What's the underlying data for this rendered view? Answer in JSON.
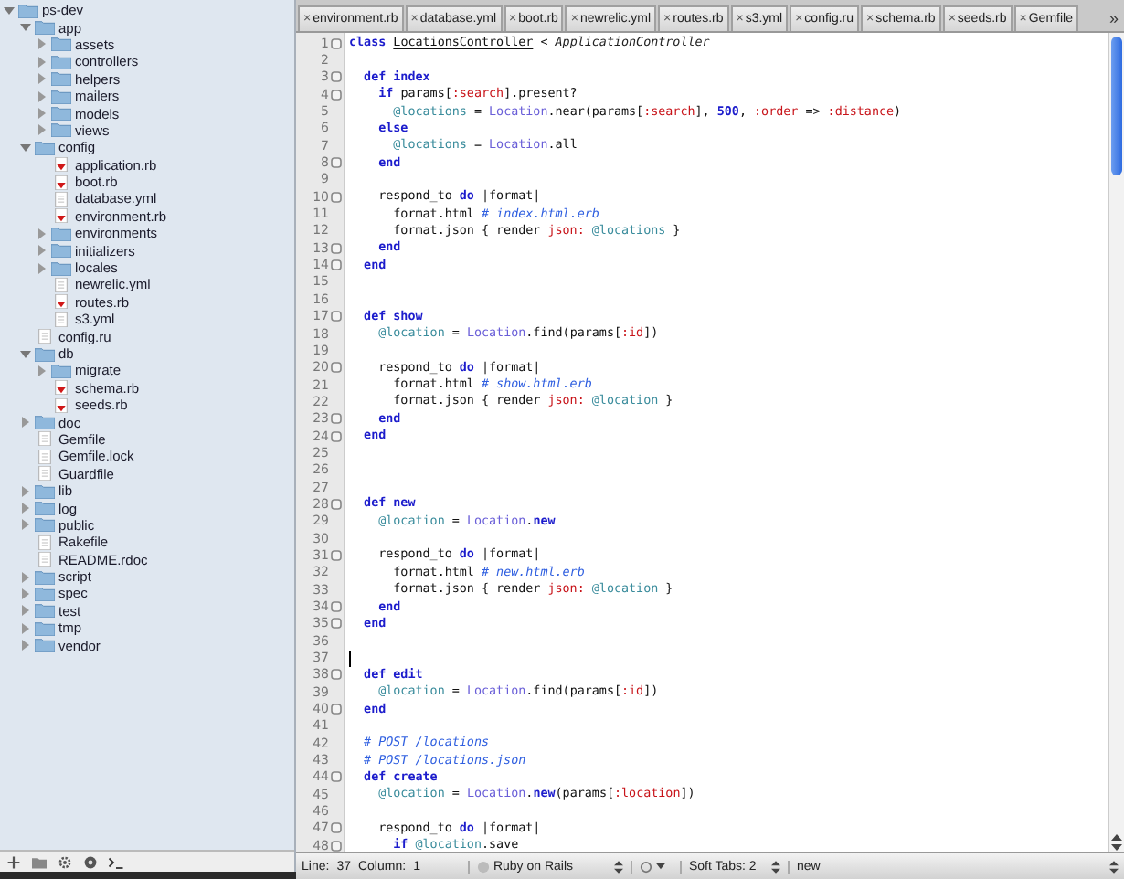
{
  "sidebar": {
    "tree": [
      {
        "name": "ps-dev",
        "kind": "folder",
        "expanded": true,
        "children": [
          {
            "name": "app",
            "kind": "folder",
            "expanded": true,
            "children": [
              {
                "name": "assets",
                "kind": "folder",
                "expanded": false
              },
              {
                "name": "controllers",
                "kind": "folder",
                "expanded": false
              },
              {
                "name": "helpers",
                "kind": "folder",
                "expanded": false
              },
              {
                "name": "mailers",
                "kind": "folder",
                "expanded": false
              },
              {
                "name": "models",
                "kind": "folder",
                "expanded": false
              },
              {
                "name": "views",
                "kind": "folder",
                "expanded": false
              }
            ]
          },
          {
            "name": "config",
            "kind": "folder",
            "expanded": true,
            "children": [
              {
                "name": "application.rb",
                "kind": "ruby"
              },
              {
                "name": "boot.rb",
                "kind": "ruby"
              },
              {
                "name": "database.yml",
                "kind": "file"
              },
              {
                "name": "environment.rb",
                "kind": "ruby"
              },
              {
                "name": "environments",
                "kind": "folder",
                "expanded": false
              },
              {
                "name": "initializers",
                "kind": "folder",
                "expanded": false
              },
              {
                "name": "locales",
                "kind": "folder",
                "expanded": false
              },
              {
                "name": "newrelic.yml",
                "kind": "file"
              },
              {
                "name": "routes.rb",
                "kind": "ruby"
              },
              {
                "name": "s3.yml",
                "kind": "file"
              }
            ]
          },
          {
            "name": "config.ru",
            "kind": "file"
          },
          {
            "name": "db",
            "kind": "folder",
            "expanded": true,
            "children": [
              {
                "name": "migrate",
                "kind": "folder",
                "expanded": false
              },
              {
                "name": "schema.rb",
                "kind": "ruby"
              },
              {
                "name": "seeds.rb",
                "kind": "ruby"
              }
            ]
          },
          {
            "name": "doc",
            "kind": "folder",
            "expanded": false
          },
          {
            "name": "Gemfile",
            "kind": "file"
          },
          {
            "name": "Gemfile.lock",
            "kind": "file"
          },
          {
            "name": "Guardfile",
            "kind": "file"
          },
          {
            "name": "lib",
            "kind": "folder",
            "expanded": false
          },
          {
            "name": "log",
            "kind": "folder",
            "expanded": false
          },
          {
            "name": "public",
            "kind": "folder",
            "expanded": false
          },
          {
            "name": "Rakefile",
            "kind": "file"
          },
          {
            "name": "README.rdoc",
            "kind": "file"
          },
          {
            "name": "script",
            "kind": "folder",
            "expanded": false
          },
          {
            "name": "spec",
            "kind": "folder",
            "expanded": false
          },
          {
            "name": "test",
            "kind": "folder",
            "expanded": false
          },
          {
            "name": "tmp",
            "kind": "folder",
            "expanded": false
          },
          {
            "name": "vendor",
            "kind": "folder",
            "expanded": false
          }
        ]
      }
    ]
  },
  "tabs": [
    {
      "close": "×",
      "label": "environment.rb"
    },
    {
      "close": "×",
      "label": "database.yml"
    },
    {
      "close": "×",
      "label": "boot.rb"
    },
    {
      "close": "×",
      "label": "newrelic.yml"
    },
    {
      "close": "×",
      "label": "routes.rb"
    },
    {
      "close": "×",
      "label": "s3.yml"
    },
    {
      "close": "×",
      "label": "config.ru"
    },
    {
      "close": "×",
      "label": "schema.rb"
    },
    {
      "close": "×",
      "label": "seeds.rb"
    },
    {
      "close": "×",
      "label": "Gemfile"
    }
  ],
  "tab_overflow": "»",
  "editor": {
    "lines": [
      {
        "number": "1",
        "fold": true,
        "caret": false,
        "tokens": [
          {
            "text": "class ",
            "kind": "keyword"
          },
          {
            "text": "LocationsController",
            "kind": "class"
          },
          {
            "text": " < ",
            "kind": "plain"
          },
          {
            "text": "ApplicationController",
            "kind": "superclass"
          }
        ]
      },
      {
        "number": "2",
        "fold": false,
        "caret": false
      },
      {
        "number": "3",
        "fold": true,
        "caret": false,
        "tokens": [
          {
            "text": "  def index",
            "kind": "keyword"
          }
        ]
      },
      {
        "number": "4",
        "fold": true,
        "caret": false,
        "tokens": [
          {
            "text": "    if ",
            "kind": "keyword"
          },
          {
            "text": "params[",
            "kind": "plain"
          },
          {
            "text": ":search",
            "kind": "symbol"
          },
          {
            "text": "].present?",
            "kind": "plain"
          }
        ]
      },
      {
        "number": "5",
        "fold": false,
        "caret": false,
        "tokens": [
          {
            "text": "      @locations",
            "kind": "ivar"
          },
          {
            "text": " = ",
            "kind": "plain"
          },
          {
            "text": "Location",
            "kind": "const"
          },
          {
            "text": ".near(params[",
            "kind": "plain"
          },
          {
            "text": ":search",
            "kind": "symbol"
          },
          {
            "text": "], ",
            "kind": "plain"
          },
          {
            "text": "500",
            "kind": "number"
          },
          {
            "text": ", ",
            "kind": "plain"
          },
          {
            "text": ":order",
            "kind": "symbol"
          },
          {
            "text": " => ",
            "kind": "plain"
          },
          {
            "text": ":distance",
            "kind": "symbol"
          },
          {
            "text": ")",
            "kind": "plain"
          }
        ]
      },
      {
        "number": "6",
        "fold": false,
        "caret": false,
        "tokens": [
          {
            "text": "    else",
            "kind": "keyword"
          }
        ]
      },
      {
        "number": "7",
        "fold": false,
        "caret": false,
        "tokens": [
          {
            "text": "      @locations",
            "kind": "ivar"
          },
          {
            "text": " = ",
            "kind": "plain"
          },
          {
            "text": "Location",
            "kind": "const"
          },
          {
            "text": ".all",
            "kind": "plain"
          }
        ]
      },
      {
        "number": "8",
        "fold": true,
        "caret": false,
        "tokens": [
          {
            "text": "    end",
            "kind": "keyword"
          }
        ]
      },
      {
        "number": "9",
        "fold": false,
        "caret": false
      },
      {
        "number": "10",
        "fold": true,
        "caret": false,
        "tokens": [
          {
            "text": "    respond_to ",
            "kind": "plain"
          },
          {
            "text": "do",
            "kind": "keyword"
          },
          {
            "text": " |format|",
            "kind": "plain"
          }
        ]
      },
      {
        "number": "11",
        "fold": false,
        "caret": false,
        "tokens": [
          {
            "text": "      format.html ",
            "kind": "plain"
          },
          {
            "text": "# index.html.erb",
            "kind": "comment"
          }
        ]
      },
      {
        "number": "12",
        "fold": false,
        "caret": false,
        "tokens": [
          {
            "text": "      format.json { render ",
            "kind": "plain"
          },
          {
            "text": "json: ",
            "kind": "symbol"
          },
          {
            "text": "@locations",
            "kind": "ivar"
          },
          {
            "text": " }",
            "kind": "plain"
          }
        ]
      },
      {
        "number": "13",
        "fold": true,
        "caret": false,
        "tokens": [
          {
            "text": "    end",
            "kind": "keyword"
          }
        ]
      },
      {
        "number": "14",
        "fold": true,
        "caret": false,
        "tokens": [
          {
            "text": "  end",
            "kind": "keyword"
          }
        ]
      },
      {
        "number": "15",
        "fold": false,
        "caret": false
      },
      {
        "number": "16",
        "fold": false,
        "caret": false
      },
      {
        "number": "17",
        "fold": true,
        "caret": false,
        "tokens": [
          {
            "text": "  def show",
            "kind": "keyword"
          }
        ]
      },
      {
        "number": "18",
        "fold": false,
        "caret": false,
        "tokens": [
          {
            "text": "    @location",
            "kind": "ivar"
          },
          {
            "text": " = ",
            "kind": "plain"
          },
          {
            "text": "Location",
            "kind": "const"
          },
          {
            "text": ".find(params[",
            "kind": "plain"
          },
          {
            "text": ":id",
            "kind": "symbol"
          },
          {
            "text": "])",
            "kind": "plain"
          }
        ]
      },
      {
        "number": "19",
        "fold": false,
        "caret": false
      },
      {
        "number": "20",
        "fold": true,
        "caret": false,
        "tokens": [
          {
            "text": "    respond_to ",
            "kind": "plain"
          },
          {
            "text": "do",
            "kind": "keyword"
          },
          {
            "text": " |format|",
            "kind": "plain"
          }
        ]
      },
      {
        "number": "21",
        "fold": false,
        "caret": false,
        "tokens": [
          {
            "text": "      format.html ",
            "kind": "plain"
          },
          {
            "text": "# show.html.erb",
            "kind": "comment"
          }
        ]
      },
      {
        "number": "22",
        "fold": false,
        "caret": false,
        "tokens": [
          {
            "text": "      format.json { render ",
            "kind": "plain"
          },
          {
            "text": "json: ",
            "kind": "symbol"
          },
          {
            "text": "@location",
            "kind": "ivar"
          },
          {
            "text": " }",
            "kind": "plain"
          }
        ]
      },
      {
        "number": "23",
        "fold": true,
        "caret": false,
        "tokens": [
          {
            "text": "    end",
            "kind": "keyword"
          }
        ]
      },
      {
        "number": "24",
        "fold": true,
        "caret": false,
        "tokens": [
          {
            "text": "  end",
            "kind": "keyword"
          }
        ]
      },
      {
        "number": "25",
        "fold": false,
        "caret": false
      },
      {
        "number": "26",
        "fold": false,
        "caret": false
      },
      {
        "number": "27",
        "fold": false,
        "caret": false
      },
      {
        "number": "28",
        "fold": true,
        "caret": false,
        "tokens": [
          {
            "text": "  def new",
            "kind": "keyword"
          }
        ]
      },
      {
        "number": "29",
        "fold": false,
        "caret": false,
        "tokens": [
          {
            "text": "    @location",
            "kind": "ivar"
          },
          {
            "text": " = ",
            "kind": "plain"
          },
          {
            "text": "Location",
            "kind": "const"
          },
          {
            "text": ".",
            "kind": "plain"
          },
          {
            "text": "new",
            "kind": "keyword"
          }
        ]
      },
      {
        "number": "30",
        "fold": false,
        "caret": false
      },
      {
        "number": "31",
        "fold": true,
        "caret": false,
        "tokens": [
          {
            "text": "    respond_to ",
            "kind": "plain"
          },
          {
            "text": "do",
            "kind": "keyword"
          },
          {
            "text": " |format|",
            "kind": "plain"
          }
        ]
      },
      {
        "number": "32",
        "fold": false,
        "caret": false,
        "tokens": [
          {
            "text": "      format.html ",
            "kind": "plain"
          },
          {
            "text": "# new.html.erb",
            "kind": "comment"
          }
        ]
      },
      {
        "number": "33",
        "fold": false,
        "caret": false,
        "tokens": [
          {
            "text": "      format.json { render ",
            "kind": "plain"
          },
          {
            "text": "json: ",
            "kind": "symbol"
          },
          {
            "text": "@location",
            "kind": "ivar"
          },
          {
            "text": " }",
            "kind": "plain"
          }
        ]
      },
      {
        "number": "34",
        "fold": true,
        "caret": false,
        "tokens": [
          {
            "text": "    end",
            "kind": "keyword"
          }
        ]
      },
      {
        "number": "35",
        "fold": true,
        "caret": false,
        "tokens": [
          {
            "text": "  end",
            "kind": "keyword"
          }
        ]
      },
      {
        "number": "36",
        "fold": false,
        "caret": false
      },
      {
        "number": "37",
        "fold": false,
        "caret": true
      },
      {
        "number": "38",
        "fold": true,
        "caret": false,
        "tokens": [
          {
            "text": "  def edit",
            "kind": "keyword"
          }
        ]
      },
      {
        "number": "39",
        "fold": false,
        "caret": false,
        "tokens": [
          {
            "text": "    @location",
            "kind": "ivar"
          },
          {
            "text": " = ",
            "kind": "plain"
          },
          {
            "text": "Location",
            "kind": "const"
          },
          {
            "text": ".find(params[",
            "kind": "plain"
          },
          {
            "text": ":id",
            "kind": "symbol"
          },
          {
            "text": "])",
            "kind": "plain"
          }
        ]
      },
      {
        "number": "40",
        "fold": true,
        "caret": false,
        "tokens": [
          {
            "text": "  end",
            "kind": "keyword"
          }
        ]
      },
      {
        "number": "41",
        "fold": false,
        "caret": false
      },
      {
        "number": "42",
        "fold": false,
        "caret": false,
        "tokens": [
          {
            "text": "  # POST /locations",
            "kind": "comment"
          }
        ]
      },
      {
        "number": "43",
        "fold": false,
        "caret": false,
        "tokens": [
          {
            "text": "  # POST /locations.json",
            "kind": "comment"
          }
        ]
      },
      {
        "number": "44",
        "fold": true,
        "caret": false,
        "tokens": [
          {
            "text": "  def create",
            "kind": "keyword"
          }
        ]
      },
      {
        "number": "45",
        "fold": false,
        "caret": false,
        "tokens": [
          {
            "text": "    @location",
            "kind": "ivar"
          },
          {
            "text": " = ",
            "kind": "plain"
          },
          {
            "text": "Location",
            "kind": "const"
          },
          {
            "text": ".",
            "kind": "plain"
          },
          {
            "text": "new",
            "kind": "keyword"
          },
          {
            "text": "(params[",
            "kind": "plain"
          },
          {
            "text": ":location",
            "kind": "symbol"
          },
          {
            "text": "])",
            "kind": "plain"
          }
        ]
      },
      {
        "number": "46",
        "fold": false,
        "caret": false
      },
      {
        "number": "47",
        "fold": true,
        "caret": false,
        "tokens": [
          {
            "text": "    respond_to ",
            "kind": "plain"
          },
          {
            "text": "do",
            "kind": "keyword"
          },
          {
            "text": " |format|",
            "kind": "plain"
          }
        ]
      },
      {
        "number": "48",
        "fold": true,
        "caret": false,
        "tokens": [
          {
            "text": "      if ",
            "kind": "keyword"
          },
          {
            "text": "@location",
            "kind": "ivar"
          },
          {
            "text": ".save",
            "kind": "plain"
          }
        ]
      }
    ]
  },
  "status_bar": {
    "line_label": "Line:",
    "line": "37",
    "column_label": "Column:",
    "column": "1",
    "language": "Ruby on Rails",
    "tabs_label": "Soft Tabs:",
    "tab_size": "2",
    "symbol": "new"
  }
}
